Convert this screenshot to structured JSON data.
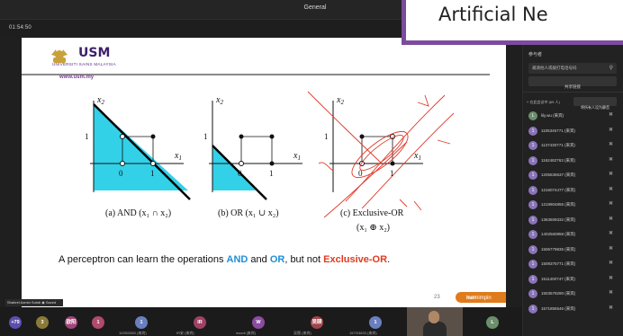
{
  "window": {
    "title": "General"
  },
  "timer": "01:54:50",
  "overlay_title": "Artificial Ne",
  "slide": {
    "uni_name": "USM",
    "uni_sub": "UNIVERSITI SAINS MALAYSIA",
    "uni_url": "www.usm.my",
    "labels": {
      "x1": "x",
      "x2": "x",
      "sub1": "1",
      "sub2": "2",
      "zero": "0",
      "one": "1"
    },
    "caption_a": "(a) AND (x₁ ∩ x₂)",
    "caption_b": "(b) OR (x₁ ∪ x₂)",
    "caption_c1": "(c) Exclusive-OR",
    "caption_c2": "(x₁ ⊕ x₂)",
    "main_caption": {
      "prefix": "A perceptron can learn the operations ",
      "and": "AND",
      "middle": " and ",
      "or": "OR",
      "suffix": ", but not ",
      "xor": "Exclusive-OR",
      "end": "."
    },
    "slide_number": "23",
    "brand": "memimpin",
    "brand_prefix": "kum"
  },
  "presenter_tag": "Shahrel Azmin Suhdi ◉ Saved",
  "panel": {
    "heading": "参与者",
    "invite_placeholder": "邀请他人或拨打电话号码",
    "share_label": "共享链接",
    "meeting_heading": "在此会议中 (69 人)",
    "mute_all": "将所有人设为静音",
    "participants": [
      {
        "initial": "L",
        "name": "lily.wu (来宾)",
        "color": "#6b8e6b"
      },
      {
        "initial": "1",
        "name": "1105345771 (来宾)",
        "color": "#8a73b8"
      },
      {
        "initial": "1",
        "name": "1137430771 (来宾)",
        "color": "#8a73b8"
      },
      {
        "initial": "1",
        "name": "1162482763 (来宾)",
        "color": "#8a73b8"
      },
      {
        "initial": "1",
        "name": "1205536637 (来宾)",
        "color": "#8a73b8"
      },
      {
        "initial": "1",
        "name": "1216074477 (来宾)",
        "color": "#8a73b8"
      },
      {
        "initial": "1",
        "name": "1219904855 (来宾)",
        "color": "#8a73b8"
      },
      {
        "initial": "1",
        "name": "1363509332 (来宾)",
        "color": "#8a73b8"
      },
      {
        "initial": "1",
        "name": "1402560858 (来宾)",
        "color": "#8a73b8"
      },
      {
        "initial": "1",
        "name": "1506779835 (来宾)",
        "color": "#8a73b8"
      },
      {
        "initial": "1",
        "name": "1509375771 (来宾)",
        "color": "#8a73b8"
      },
      {
        "initial": "1",
        "name": "1511400747 (来宾)",
        "color": "#8a73b8"
      },
      {
        "initial": "1",
        "name": "1503579290 (来宾)",
        "color": "#8a73b8"
      },
      {
        "initial": "1",
        "name": "1571855546 (来宾)",
        "color": "#8a73b8"
      }
    ]
  },
  "bottom": {
    "tiles": [
      {
        "label": "+79",
        "color": "#5a4fb0"
      },
      {
        "label": "3",
        "color": "#8a7a3a"
      },
      {
        "label": "欧阳",
        "color": "#a0467a"
      },
      {
        "label": "1",
        "color": "#b04a6e"
      },
      {
        "label": "1",
        "color": "#6a7fc0"
      },
      {
        "label": "IR",
        "color": "#a04064"
      },
      {
        "label": "W",
        "color": "#8a4ca0"
      },
      {
        "label": "吴颐",
        "color": "#a0464a"
      },
      {
        "label": "1",
        "color": "#6a7fc0"
      },
      {
        "label": "L",
        "color": "#6b8e6b"
      }
    ],
    "tile_names": [
      "1025/2883 (来宾)",
      "IR安 (来宾)",
      "woodi (来宾)",
      "吴颐 (来宾)",
      "1573/3833 (来宾)"
    ]
  }
}
